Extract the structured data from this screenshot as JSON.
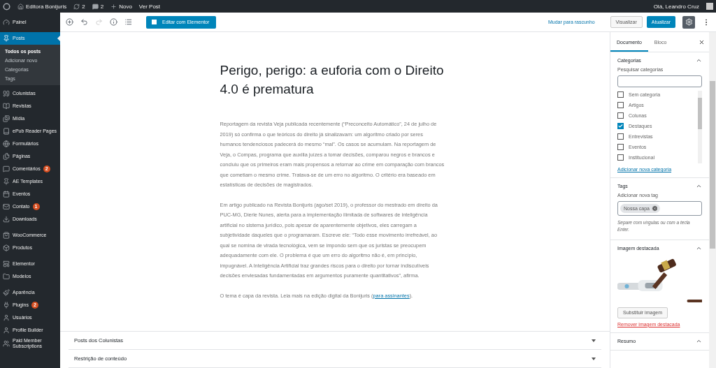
{
  "admin_bar": {
    "site_name": "Editora Bonijuris",
    "updates_count": "2",
    "comments_count": "2",
    "new_label": "Novo",
    "view_post": "Ver Post",
    "greeting": "Olá, Leandro Cruz"
  },
  "sidebar": {
    "groups": [
      {
        "items": [
          {
            "label": "Painel",
            "selected": false
          }
        ]
      },
      {
        "items": [
          {
            "label": "Posts",
            "selected": true,
            "children": [
              {
                "label": "Todos os posts",
                "selected": true
              },
              {
                "label": "Adicionar novo",
                "selected": false
              },
              {
                "label": "Categorias",
                "selected": false
              },
              {
                "label": "Tags",
                "selected": false
              }
            ]
          },
          {
            "label": "Colunistas",
            "selected": false
          },
          {
            "label": "Revistas",
            "selected": false
          },
          {
            "label": "Mídia",
            "selected": false
          },
          {
            "label": "ePub Reader Pages",
            "selected": false
          },
          {
            "label": "Formulários",
            "selected": false
          },
          {
            "label": "Páginas",
            "selected": false
          },
          {
            "label": "Comentários",
            "selected": false,
            "badge": "2"
          },
          {
            "label": "AE Templates",
            "selected": false
          },
          {
            "label": "Eventos",
            "selected": false
          },
          {
            "label": "Contato",
            "selected": false,
            "badge": "1"
          },
          {
            "label": "Downloads",
            "selected": false
          }
        ]
      },
      {
        "items": [
          {
            "label": "WooCommerce",
            "selected": false
          },
          {
            "label": "Produtos",
            "selected": false
          }
        ]
      },
      {
        "items": [
          {
            "label": "Elementor",
            "selected": false
          },
          {
            "label": "Modelos",
            "selected": false
          }
        ]
      },
      {
        "items": [
          {
            "label": "Aparência",
            "selected": false
          },
          {
            "label": "Plugins",
            "selected": false,
            "badge": "2"
          },
          {
            "label": "Usuários",
            "selected": false
          },
          {
            "label": "Profile Builder",
            "selected": false
          },
          {
            "label": "Paid Member Subscriptions",
            "selected": false
          }
        ]
      }
    ]
  },
  "toolbar": {
    "elementor_button": "Editar com Elementor",
    "draft_link": "Mudar para rascunho",
    "preview_button": "Visualizar",
    "update_button": "Atualizar"
  },
  "post": {
    "title": "Perigo, perigo: a euforia com o Direito 4.0 é prematura",
    "paragraphs": [
      {
        "text": "Reportagem da revista Veja publicada recentemente (“Preconceito Automático”, 24 de julho de 2019) só confirma o que teóricos do direito já sinalizavam: um algoritmo criado por seres humanos tendenciosos padecerá do mesmo “mal”. Os casos se acumulam. Na reportagem de Veja, o Compas, programa que auxilia juízes a tomar decisões, comparou negros e brancos e concluiu que os primeiros eram mais propensos a retornar ao crime em comparação com brancos que cometiam o mesmo crime. Tratava-se de um erro no algoritmo. O critério era baseado em estatísticas de decisões de magistrados."
      },
      {
        "text": "Em artigo publicado na Revista Bonijuris (ago/set 2019), o professor do mestrado em direito da PUC-MG, Dierle Nunes, alerta para a implementação ilimitada de softwares de inteligência artificial no sistema jurídico, pois apesar de aparentemente objetivos, eles carregam a subjetividade daqueles que o programaram. Escreve ele: “Todo esse movimento irrefreável, ao qual se nomina de virada tecnológica, vem se impondo sem que os juristas se preocupem adequadamente com ele. O problema é que um erro do algoritmo não é, em princípio, impugnável. A Inteligência Artificial traz grandes riscos para o direito por tornar indiscutíveis decisões enviesadas fundamentadas em argumentos puramente quantitativos”, afirma."
      },
      {
        "text": "O tema é capa da revista. Leia mais na edição digital da Bonijuris (",
        "link": "para assinantes",
        "after": ")."
      }
    ]
  },
  "meta_boxes": [
    {
      "title": "Posts dos Colunistas",
      "expanded": false
    },
    {
      "title": "Restrição de conteúdo",
      "expanded": false
    }
  ],
  "settings": {
    "tabs": [
      {
        "label": "Documento",
        "selected": true
      },
      {
        "label": "Bloco",
        "selected": false
      }
    ],
    "categories": {
      "title": "Categorias",
      "search_label": "Pesquisar categorias",
      "items": [
        {
          "label": "Sem categoria",
          "checked": false
        },
        {
          "label": "Artigos",
          "checked": false
        },
        {
          "label": "Colunas",
          "checked": false
        },
        {
          "label": "Destaques",
          "checked": true
        },
        {
          "label": "Entrevistas",
          "checked": false
        },
        {
          "label": "Eventos",
          "checked": false
        },
        {
          "label": "Institucional",
          "checked": false
        }
      ],
      "add_link": "Adicionar nova categoria"
    },
    "tags": {
      "title": "Tags",
      "field_label": "Adicionar nova tag",
      "tokens": [
        "Nossa capa"
      ],
      "help": "Separe com vírgulas ou com a tecla Enter."
    },
    "featured_image": {
      "title": "Imagem destacada",
      "replace_button": "Substituir imagem",
      "remove_link": "Remover imagem destacada"
    },
    "excerpt": {
      "title": "Resumo"
    }
  }
}
